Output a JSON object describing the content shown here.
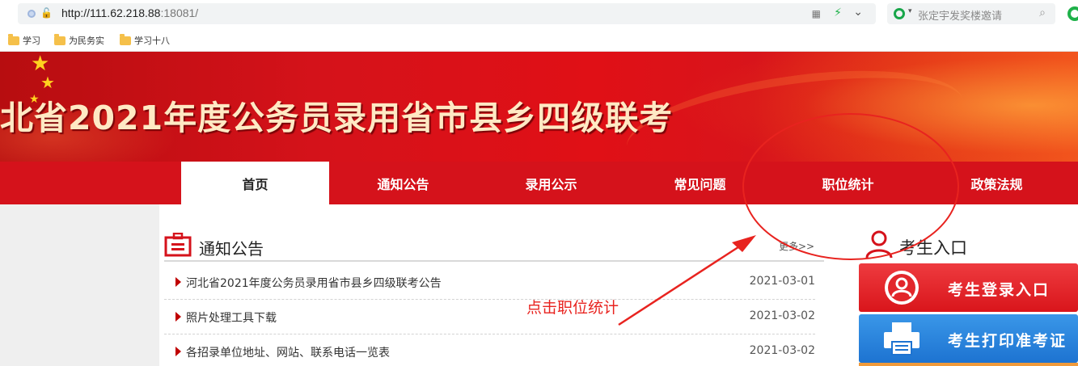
{
  "browser": {
    "url_host": "http://111.62.218.88",
    "url_port": ":18081/",
    "search_placeholder": "张定宇发奖楼邀请",
    "bookmarks": [
      "学习",
      "为民务实",
      "学习十八"
    ]
  },
  "banner": {
    "title": "北省2021年度公务员录用省市县乡四级联考"
  },
  "nav": {
    "items": [
      "首页",
      "通知公告",
      "录用公示",
      "常见问题",
      "职位统计",
      "政策法规"
    ],
    "active_index": 0
  },
  "notice": {
    "title": "通知公告",
    "more": "更多>>",
    "rows": [
      {
        "title": "河北省2021年度公务员录用省市县乡四级联考公告",
        "date": "2021-03-01"
      },
      {
        "title": "照片处理工具下载",
        "date": "2021-03-02"
      },
      {
        "title": "各招录单位地址、网站、联系电话一览表",
        "date": "2021-03-02"
      }
    ]
  },
  "entry": {
    "title": "考生入口",
    "login_label": "考生登录入口",
    "print_label": "考生打印准考证"
  },
  "annotation": {
    "text": "点击职位统计"
  },
  "colors": {
    "brand_red": "#d5121b",
    "annotation_red": "#e8231f",
    "print_blue": "#1d73d1"
  }
}
